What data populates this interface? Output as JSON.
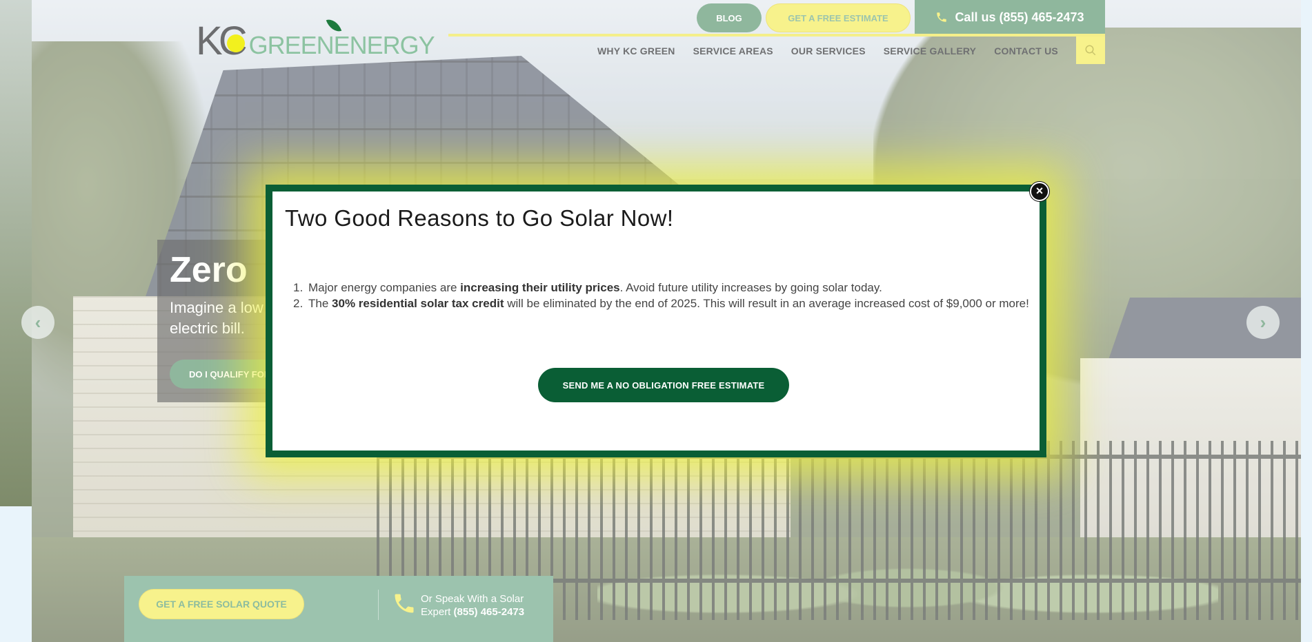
{
  "header": {
    "logo": {
      "letters_k": "K",
      "letters_c": "C",
      "brand": "GREENENERGY"
    },
    "blog_label": "BLOG",
    "estimate_label": "GET A FREE ESTIMATE",
    "call_label": "Call us (855) 465-2473",
    "nav": [
      {
        "label": "WHY KC GREEN"
      },
      {
        "label": "SERVICE AREAS"
      },
      {
        "label": "OUR SERVICES"
      },
      {
        "label": "SERVICE GALLERY"
      },
      {
        "label": "CONTACT US"
      }
    ],
    "search_icon": "search-icon"
  },
  "hero": {
    "title": "Zero",
    "text": "Imagine a low electric bill.",
    "button_label": "DO I QUALIFY FOR",
    "prev_icon": "chevron-left-icon",
    "next_icon": "chevron-right-icon"
  },
  "cta_bar": {
    "quote_label": "GET A FREE SOLAR QUOTE",
    "speak_text": "Or Speak With a Solar Expert",
    "speak_phone": "(855) 465-2473"
  },
  "modal": {
    "title": "Two Good Reasons to Go Solar Now!",
    "items": [
      {
        "num": "1.",
        "before": "Major energy companies are ",
        "bold": "increasing their utility prices",
        "after": ". Avoid future utility increases by going solar today."
      },
      {
        "num": "2.",
        "before": "The ",
        "bold": "30% residential solar tax credit",
        "after": " will be eliminated by the end of 2025. This will result in an average increased cost of $9,000 or more!"
      }
    ],
    "cta_label": "SEND ME A NO OBLIGATION FREE ESTIMATE",
    "close_glyph": "×"
  },
  "colors": {
    "brand_green": "#8fb79d",
    "dark_green": "#0a5e35",
    "accent_yellow": "#f7f28c"
  }
}
